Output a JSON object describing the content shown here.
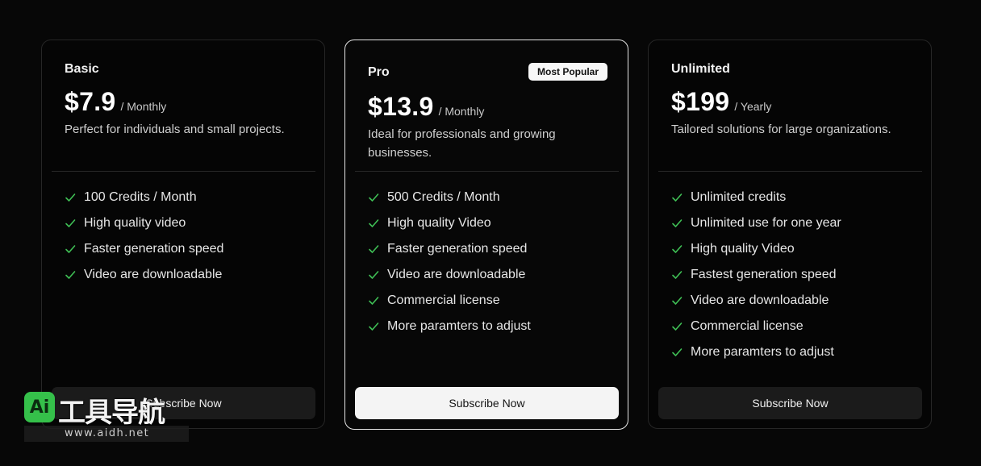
{
  "plans": [
    {
      "name": "Basic",
      "price": "$7.9",
      "period": "/ Monthly",
      "description": "Perfect for individuals and small projects.",
      "features": [
        "100 Credits / Month",
        "High quality video",
        "Faster generation speed",
        "Video are downloadable"
      ],
      "button_label": "Subscribe Now"
    },
    {
      "name": "Pro",
      "badge": "Most Popular",
      "price": "$13.9",
      "period": "/ Monthly",
      "description": "Ideal for professionals and growing businesses.",
      "features": [
        "500 Credits / Month",
        "High quality Video",
        "Faster generation speed",
        "Video are downloadable",
        "Commercial license",
        "More paramters to adjust"
      ],
      "button_label": "Subscribe Now"
    },
    {
      "name": "Unlimited",
      "price": "$199",
      "period": "/ Yearly",
      "description": "Tailored solutions for large organizations.",
      "features": [
        "Unlimited credits",
        "Unlimited use for one year",
        "High quality Video",
        "Fastest generation speed",
        "Video are downloadable",
        "Commercial license",
        "More paramters to adjust"
      ],
      "button_label": "Subscribe Now"
    }
  ],
  "watermark": {
    "logo_text": "Ai",
    "title": "工具导航",
    "url": "www.aidh.net"
  },
  "colors": {
    "check": "#3fbf55",
    "background": "#070707",
    "featured_border": "#e6e6e6",
    "watermark_green": "#35c04a"
  },
  "icons": {
    "feature_bullet": "check-icon"
  }
}
